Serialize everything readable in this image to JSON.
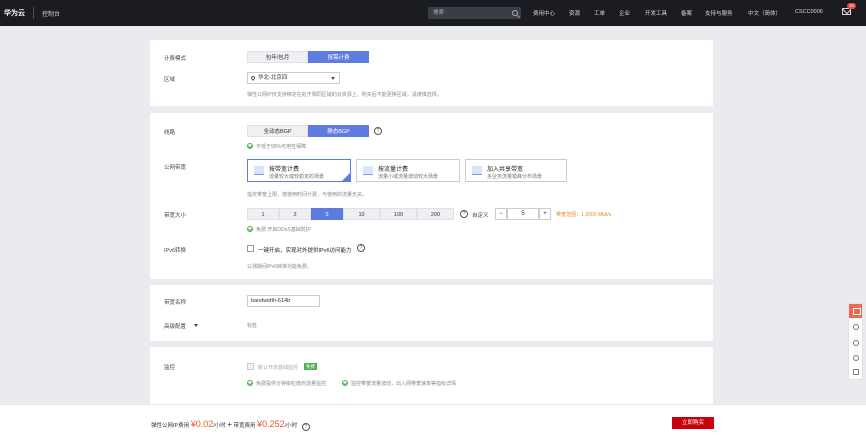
{
  "topbar": {
    "brand": "华为云",
    "console": "控制台",
    "search_placeholder": "搜索",
    "nav": [
      "费用中心",
      "资源",
      "工单",
      "企业",
      "开发工具",
      "备案",
      "支持与服务",
      "中文（简体）",
      "CSCC0006"
    ],
    "mail_badge": "10"
  },
  "billing": {
    "label": "计费模式",
    "options": [
      "包年/包月",
      "按需计费"
    ],
    "selected": 1
  },
  "region": {
    "label": "区域",
    "value": "华北-北京四",
    "hint": "弹性公网IP仅支持绑定在处于相同区域的云资源上。购买后不能更换区域，请谨慎选择。"
  },
  "line": {
    "label": "线路",
    "options": [
      "全动态BGP",
      "静态BGP"
    ],
    "selected": 1,
    "note": "不低于99%可用性保障"
  },
  "public_bandwidth": {
    "label": "公网带宽",
    "cards": [
      {
        "title": "按带宽计费",
        "desc": "流量较大或较稳定的场景"
      },
      {
        "title": "按流量计费",
        "desc": "流量小或流量波动较大场景"
      },
      {
        "title": "加入共享带宽",
        "desc": "多业务流量错峰分布场景"
      }
    ],
    "selected": 0,
    "hint": "指定带宽上限，按使用时间计费，与使用的流量无关。"
  },
  "bandwidth_size": {
    "label": "带宽大小",
    "options": [
      "1",
      "2",
      "5",
      "10",
      "100",
      "200"
    ],
    "selected": 2,
    "custom_label": "自定义",
    "value": "5",
    "range": "带宽范围：1-2000 Mbit/s",
    "ddos_note": "免费 开启DDoS基础防护"
  },
  "ipv6": {
    "label": "IPv6转换",
    "checkbox_label": "一键开启，实现对外提供IPv6访问能力",
    "hint": "公测期间IPv6转换功能免费。"
  },
  "bandwidth_name": {
    "label": "带宽名称",
    "value": "bandwidth-614b"
  },
  "advanced": {
    "label": "高级配置",
    "tag": "标签"
  },
  "monitor": {
    "label": "监控",
    "checkbox_label": "默认开启基础监控",
    "free_tag": "免费",
    "feature1": "免费提供分钟级粒度的流量监控",
    "feature2": "监控带宽流量波动，出入网带宽速率等指标详情"
  },
  "footer": {
    "fee_prefix": "弹性公网IP费用",
    "ip_price": "¥0.02",
    "per_hour": "/小时",
    "plus": "+",
    "bw_fee_label": "带宽费用",
    "bw_price": "¥0.252",
    "buy_label": "立即购买"
  },
  "colors": {
    "primary": "#5e7ce0",
    "buy": "#c7000b",
    "price": "#e65a2e",
    "ok": "#4caf50"
  }
}
